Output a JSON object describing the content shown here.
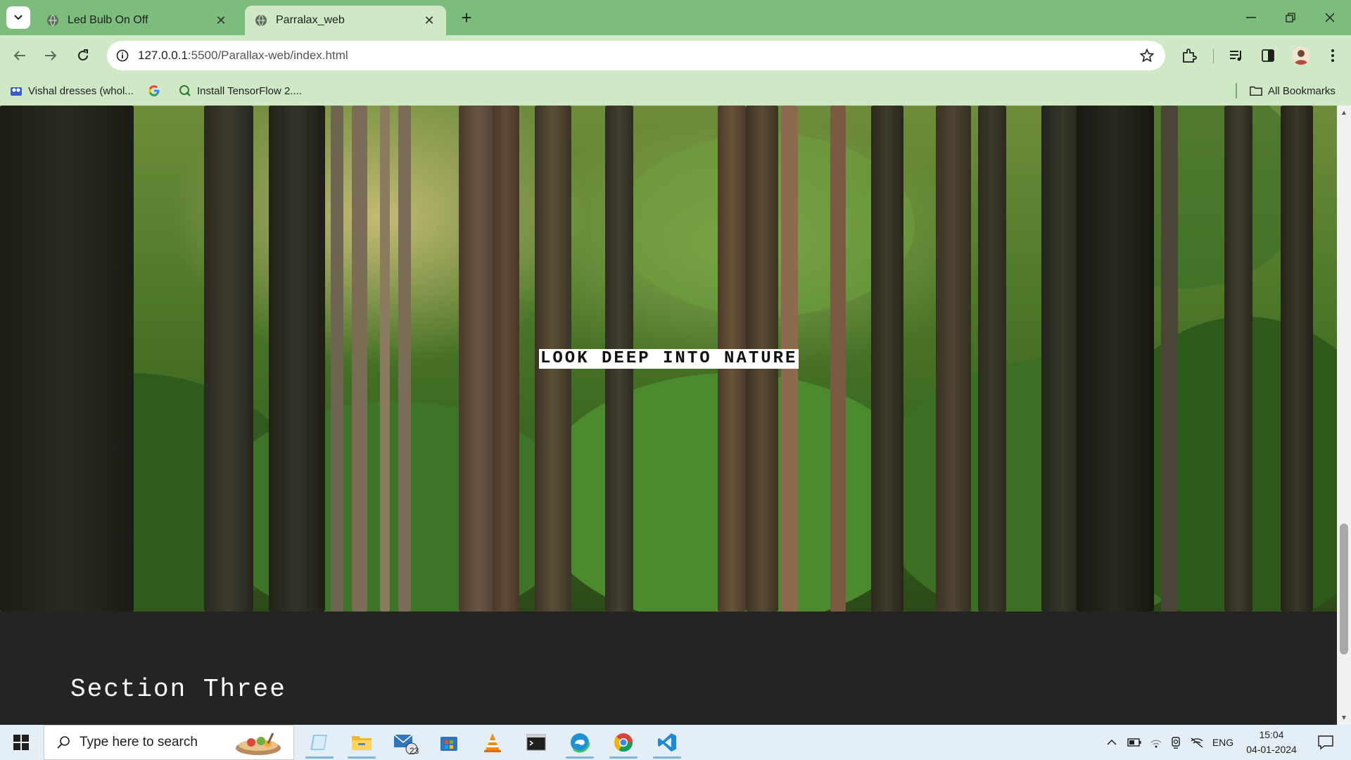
{
  "browser": {
    "tabs": [
      {
        "title": "Led Bulb On Off",
        "active": false
      },
      {
        "title": "Parralax_web",
        "active": true
      }
    ],
    "address": {
      "host": "127.0.0.1",
      "rest": ":5500/Parallax-web/index.html"
    },
    "bookmarks": [
      {
        "label": "Vishal dresses (whol...",
        "icon": "dresses-favicon"
      },
      {
        "label": "",
        "icon": "google-icon"
      },
      {
        "label": "Install TensorFlow 2....",
        "icon": "tensorflow-favicon"
      }
    ],
    "all_bookmarks_label": "All Bookmarks"
  },
  "page": {
    "hero_caption": "LOOK DEEP INTO NATURE",
    "section_title": "Section Three"
  },
  "taskbar": {
    "search_placeholder": "Type here to search",
    "mail_badge": "23",
    "language": "ENG",
    "time": "15:04",
    "date": "04-01-2024"
  },
  "colors": {
    "tabstrip": "#7cbc7c",
    "toolbar": "#cfe8c5",
    "page_dark": "#242424"
  }
}
